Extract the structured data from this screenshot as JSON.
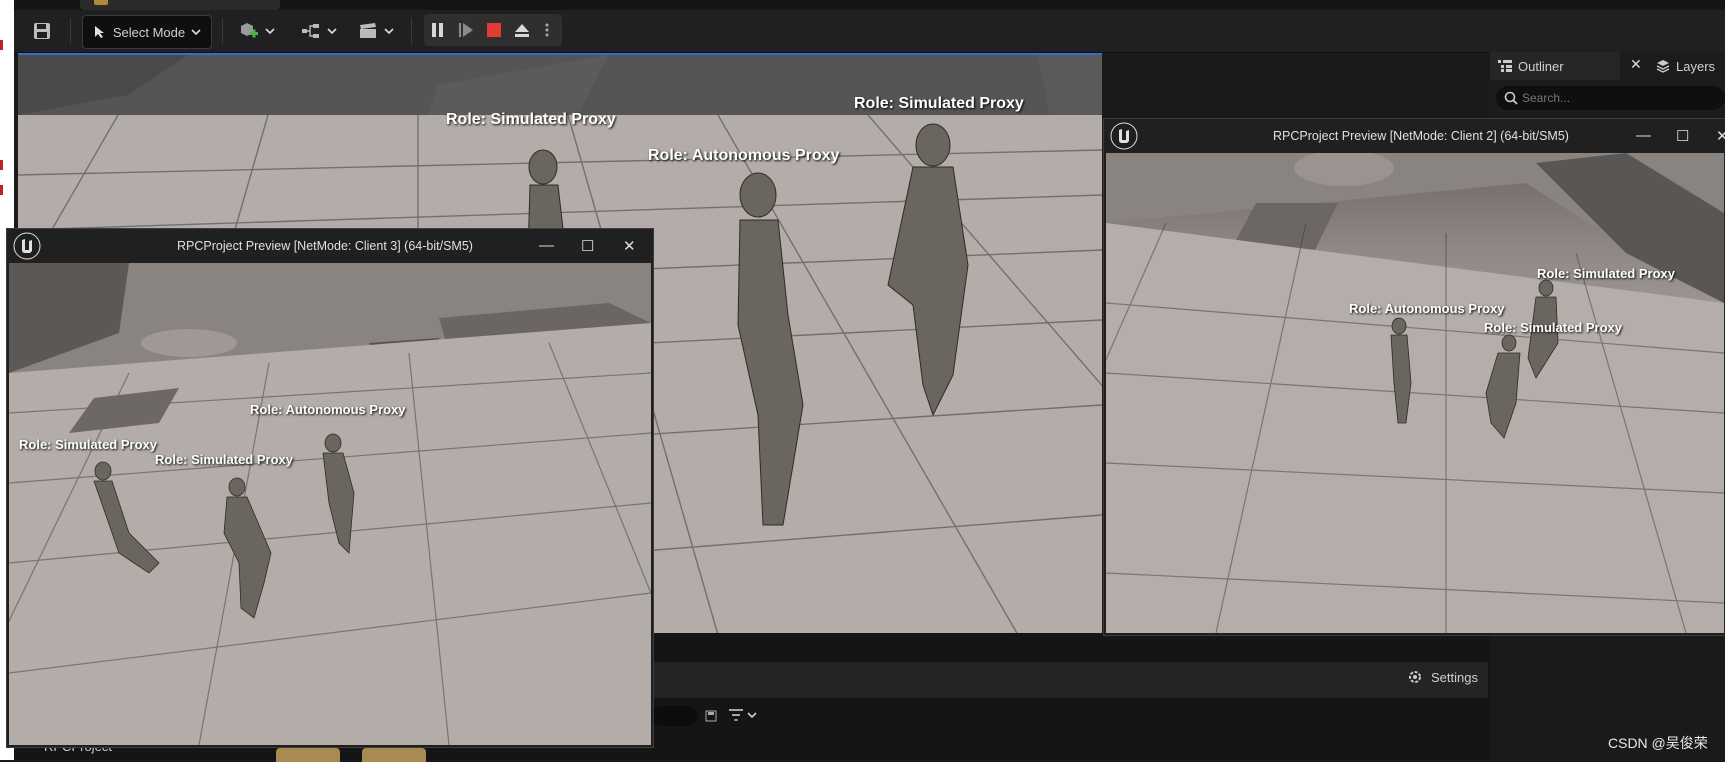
{
  "toolbar": {
    "mode_label": "Select Mode"
  },
  "main_viewport": {
    "roles": [
      "Role: Simulated Proxy",
      "Role: Autonomous Proxy",
      "Role: Simulated Proxy"
    ]
  },
  "outliner": {
    "tab_label": "Outliner",
    "layers_label": "Layers",
    "search_placeholder": "Search..."
  },
  "client3": {
    "title": "RPCProject Preview [NetMode: Client 3]  (64-bit/SM5)",
    "roles": [
      "Role: Autonomous Proxy",
      "Role: Simulated Proxy",
      "Role: Simulated Proxy"
    ]
  },
  "client2": {
    "title": "RPCProject Preview [NetMode: Client 2]  (64-bit/SM5)",
    "roles": [
      "Role: Simulated Proxy",
      "Role: Autonomous Proxy",
      "Role: Simulated Proxy"
    ]
  },
  "bottom": {
    "settings_label": "Settings",
    "tree_label": "RPCProject"
  },
  "watermark": "CSDN @吴俊荣",
  "colors": {
    "accent": "#2f6fd1",
    "stop": "#e53935",
    "window_bg": "#1f1f1f"
  }
}
